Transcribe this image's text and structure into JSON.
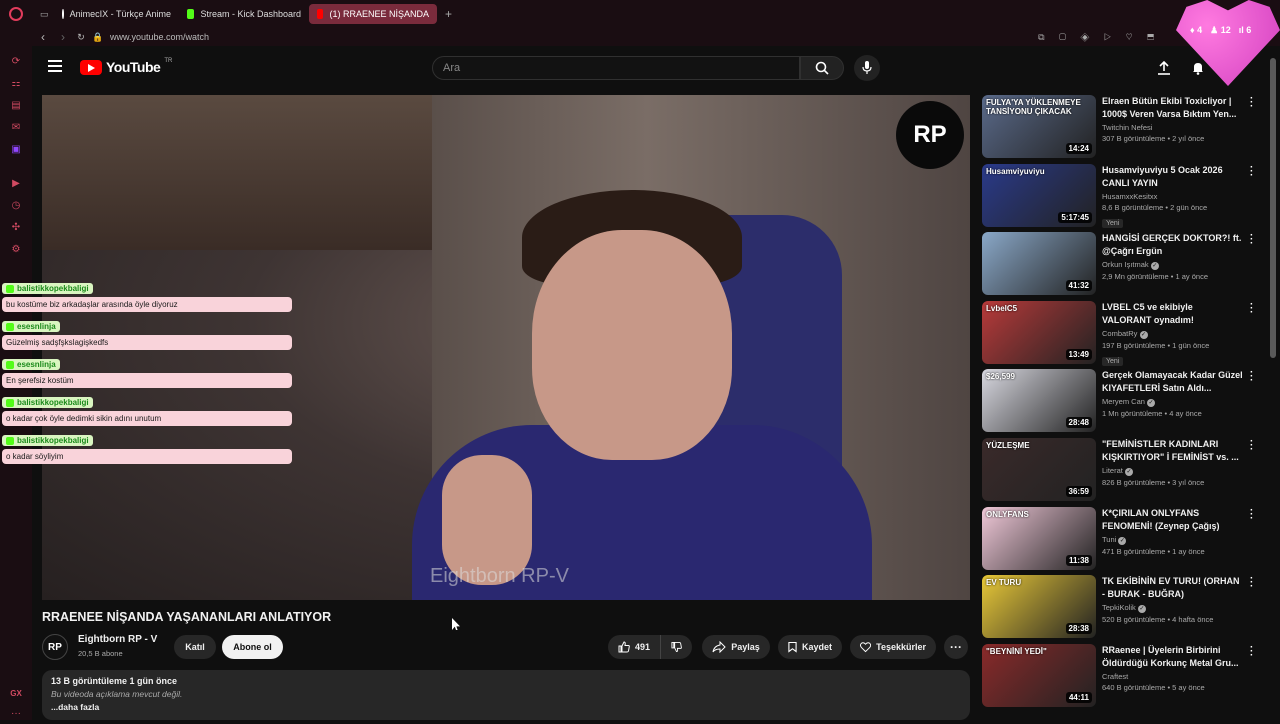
{
  "browser": {
    "tabs": [
      {
        "label": "AnimecIX - Türkçe Anime",
        "favicon_color": "#ffffff"
      },
      {
        "label": "Stream - Kick Dashboard",
        "favicon_color": "#53fc18"
      },
      {
        "label": "(1) RRAENEE NİŞANDA",
        "favicon_color": "#ff0000",
        "active": true
      }
    ],
    "url": "www.youtube.com/watch"
  },
  "header": {
    "logo_text": "YouTube",
    "logo_region": "TR",
    "search_placeholder": "Ara"
  },
  "kick_overlay": {
    "stat1": "4",
    "stat2": "12",
    "stat3": "6"
  },
  "video": {
    "watermark": "Eightborn RP-V",
    "logo_text": "RP",
    "chat": [
      {
        "user": "balistikkopekbaligi",
        "text": "bu kostüme biz arkadaşlar arasında öyle diyoruz"
      },
      {
        "user": "esesnlinja",
        "text": "Güzelmiş sadşfşkslagişkedfs"
      },
      {
        "user": "esesnlinja",
        "text": "En şerefsiz kostüm"
      },
      {
        "user": "balistikkopekbaligi",
        "text": "o kadar çok öyle dedimki sikin adını unutum"
      },
      {
        "user": "balistikkopekbaligi",
        "text": "o kadar söyliyim"
      }
    ]
  },
  "watch": {
    "title": "RRAENEE NİŞANDA YAŞANANLARI ANLATIYOR",
    "channel_name": "Eightborn RP - V",
    "channel_subs": "20,5 B abone",
    "avatar_text": "RP",
    "join_label": "Katıl",
    "subscribe_label": "Abone ol",
    "likes": "491",
    "share_label": "Paylaş",
    "save_label": "Kaydet",
    "thanks_label": "Teşekkürler",
    "views_meta": "13 B görüntüleme  1 gün önce",
    "description": "Bu videoda açıklama mevcut değil.",
    "more_label": "...daha fazla"
  },
  "recommendations": [
    {
      "title": "Elraen Bütün Ekibi Toxicliyor | 1000$ Veren Varsa Bıktım Yen...",
      "channel": "Twitchin Nefesi",
      "stats": "307 B görüntüleme • 2 yıl önce",
      "duration": "14:24",
      "thumb_text": "FULYA'YA YÜKLENMEYE TANSİYONU ÇIKACAK",
      "thumb_color": "#5a6a8a",
      "verified": false,
      "badge": ""
    },
    {
      "title": "Husamviyuviyu 5 Ocak 2026 CANLI YAYIN",
      "channel": "HusamxxKesitxx",
      "stats": "8,6 B görüntüleme • 2 gün önce",
      "duration": "5:17:45",
      "thumb_text": "Husamviyuviyu",
      "thumb_color": "#2a3a8a",
      "verified": false,
      "badge": "Yeni"
    },
    {
      "title": "HANGİSİ GERÇEK DOKTOR?! ft. @Çağrı Ergün",
      "channel": "Orkun Işıtmak",
      "stats": "2,9 Mn görüntüleme • 1 ay önce",
      "duration": "41:32",
      "thumb_text": "",
      "thumb_color": "#8aa8c8",
      "verified": true,
      "badge": ""
    },
    {
      "title": "LVBEL C5 ve ekibiyle VALORANT oynadım!",
      "channel": "CombatRy",
      "stats": "197 B görüntüleme • 1 gün önce",
      "duration": "13:49",
      "thumb_text": "LvbelC5",
      "thumb_color": "#b83a3a",
      "verified": true,
      "badge": "Yeni"
    },
    {
      "title": "Gerçek Olamayacak Kadar Güzel KIYAFETLERİ Satın Aldı...",
      "channel": "Meryem Can",
      "stats": "1 Mn görüntüleme • 4 ay önce",
      "duration": "28:48",
      "thumb_text": "$26,599",
      "thumb_color": "#d8d8e0",
      "verified": true,
      "badge": ""
    },
    {
      "title": "\"FEMİNİSTLER KADINLARI KIŞKIRTIYOR\" İ FEMİNİST vs. ...",
      "channel": "Literat",
      "stats": "826 B görüntüleme • 3 yıl önce",
      "duration": "36:59",
      "thumb_text": "YÜZLEŞME",
      "thumb_color": "#3a2a2a",
      "verified": true,
      "badge": ""
    },
    {
      "title": "K*ÇIRILAN ONLYFANS FENOMENİ! (Zeynep Çağış)",
      "channel": "Tuni",
      "stats": "471 B görüntüleme • 1 ay önce",
      "duration": "11:38",
      "thumb_text": "ONLYFANS",
      "thumb_color": "#f0c8d8",
      "verified": true,
      "badge": ""
    },
    {
      "title": "TK EKİBİNİN EV TURU! (ORHAN - BURAK - BUĞRA)",
      "channel": "TepkiKolik",
      "stats": "520 B görüntüleme • 4 hafta önce",
      "duration": "28:38",
      "thumb_text": "EV TURU",
      "thumb_color": "#e8c838",
      "verified": true,
      "badge": ""
    },
    {
      "title": "RRaenee | Üyelerin Birbirini Öldürdüğü Korkunç Metal Gru...",
      "channel": "Craftest",
      "stats": "640 B görüntüleme • 5 ay önce",
      "duration": "44:11",
      "thumb_text": "\"BEYNİNİ YEDİ\"",
      "thumb_color": "#8a2a2a",
      "verified": false,
      "badge": ""
    }
  ]
}
